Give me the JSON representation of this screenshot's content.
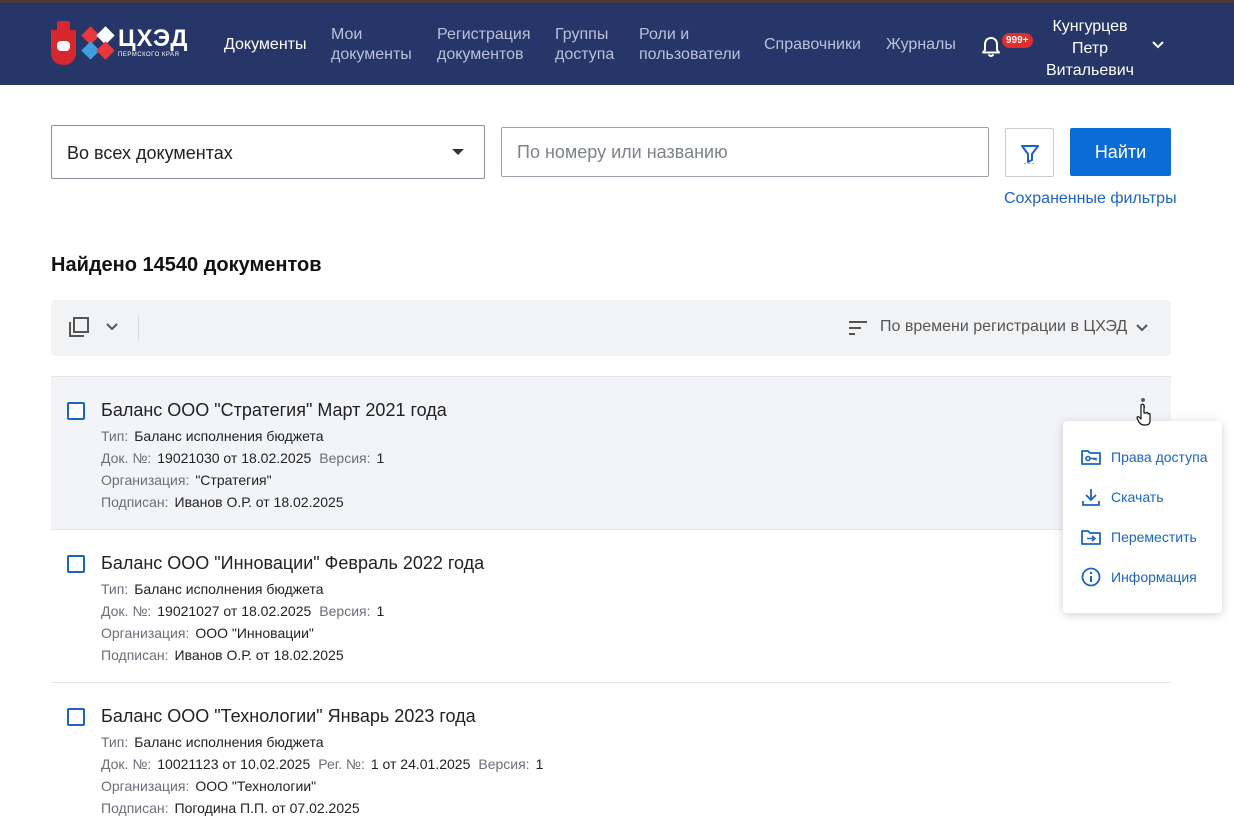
{
  "header": {
    "logo": {
      "title": "ЦХЭД",
      "subtitle": "Пермского края"
    },
    "nav": [
      {
        "label": "Документы",
        "active": true
      },
      {
        "label": "Мои\nдокументы"
      },
      {
        "label": "Регистрация\nдокументов"
      },
      {
        "label": "Группы\nдоступа"
      },
      {
        "label": "Роли и\nпользователи"
      },
      {
        "label": "Справочники"
      },
      {
        "label": "Журналы"
      }
    ],
    "notifications_badge": "999+",
    "user": {
      "last_name": "Кунгурцев",
      "first_name": "Петр",
      "patronymic": "Витальевич"
    }
  },
  "search": {
    "scope_value": "Во всех документах",
    "placeholder": "По номеру или названию",
    "value": "",
    "find_label": "Найти",
    "saved_filters_label": "Сохраненные фильтры"
  },
  "results": {
    "title": "Найдено 14540 документов",
    "sort_label": "По времени регистрации в ЦХЭД"
  },
  "labels": {
    "type": "Тип:",
    "doc_no": "Док. №:",
    "version": "Версия:",
    "reg_no": "Рег. №:",
    "org": "Организация:",
    "signed": "Подписан:"
  },
  "documents": [
    {
      "title": "Баланс ООО \"Стратегия\" Март 2021 года",
      "type": "Баланс исполнения бюджета",
      "doc_no": "19021030 от 18.02.2025",
      "version": "1",
      "org": "\"Стратегия\"",
      "signed": "Иванов О.Р. от 18.02.2025"
    },
    {
      "title": "Баланс ООО \"Инновации\" Февраль 2022 года",
      "type": "Баланс исполнения бюджета",
      "doc_no": "19021027 от 18.02.2025",
      "version": "1",
      "org": "ООО \"Инновации\"",
      "signed": "Иванов О.Р. от 18.02.2025"
    },
    {
      "title": "Баланс ООО \"Технологии\" Январь 2023 года",
      "type": "Баланс исполнения бюджета",
      "doc_no": "10021123 от 10.02.2025",
      "reg_no": "1 от 24.01.2025",
      "version": "1",
      "org": "ООО \"Технологии\"",
      "signed": "Погодина П.П. от 07.02.2025"
    }
  ],
  "context_menu": [
    {
      "label": "Права доступа",
      "icon": "folder-key-icon"
    },
    {
      "label": "Скачать",
      "icon": "download-icon"
    },
    {
      "label": "Переместить",
      "icon": "folder-move-icon"
    },
    {
      "label": "Информация",
      "icon": "info-icon"
    }
  ],
  "colors": {
    "header_bg": "#273668",
    "accent": "#0a6cd6",
    "link": "#1a64c8",
    "badge": "#e32d2d"
  }
}
